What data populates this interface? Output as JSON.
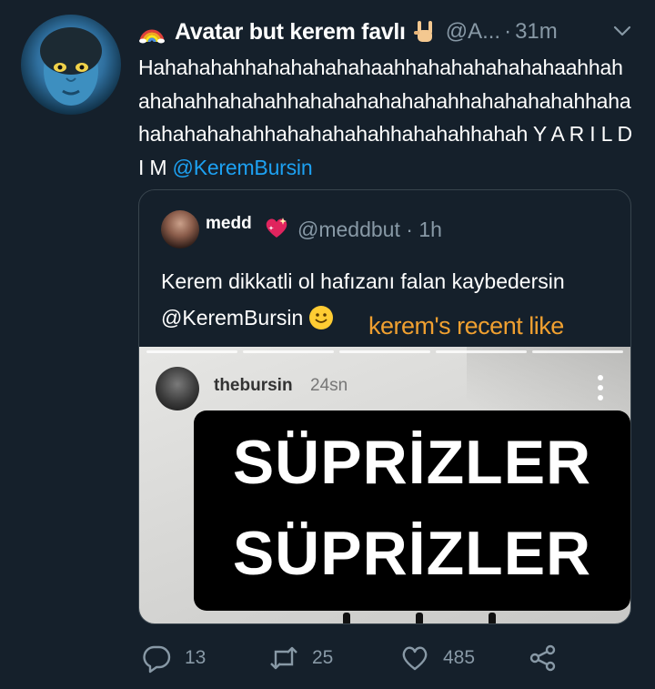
{
  "tweet": {
    "display_name": "Avatar but kerem favlı",
    "handle": "@A...",
    "separator": "·",
    "time": "31m",
    "text": "Hahahahahhahahahahahaahhahahahahahahaahhahahahahhahahahhahahahahahahahhahahahahahhahahahahahahahhahahahahahhahahahhahah Y A R I L D I M",
    "mention": "@KeremBursin",
    "icons": [
      "rainbow-icon",
      "rock-hand-icon",
      "chevron-down-icon"
    ]
  },
  "quote": {
    "name": "medd",
    "handle": "@meddbut",
    "separator": "·",
    "time": "1h",
    "text": "Kerem dikkatli ol hafızanı falan kaybedersin",
    "mention": "@KeremBursin",
    "overlay_label": "kerem's recent like",
    "icons": [
      "sparkling-heart-icon",
      "smiley-icon"
    ]
  },
  "story": {
    "username": "thebursin",
    "time": "24sn",
    "sticker_lines": [
      "SÜPRİZLER",
      "SÜPRİZLER"
    ],
    "icons": [
      "more-vertical-icon"
    ]
  },
  "actions": {
    "reply_count": "13",
    "retweet_count": "25",
    "like_count": "485",
    "icons": [
      "reply-icon",
      "retweet-icon",
      "like-icon",
      "share-icon"
    ]
  },
  "colors": {
    "background": "#15202b",
    "muted": "#8899a6",
    "link": "#1da1f2",
    "border": "#38444d",
    "overlay_label": "#f0a030"
  }
}
